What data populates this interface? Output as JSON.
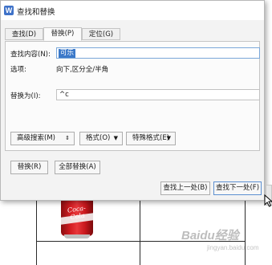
{
  "dialog": {
    "title": "查找和替换",
    "app_icon_letter": "W",
    "tabs": [
      {
        "label": "查找(D)",
        "active": false
      },
      {
        "label": "替换(P)",
        "active": true
      },
      {
        "label": "定位(G)",
        "active": false
      }
    ],
    "find": {
      "label": "查找内容(N):",
      "value": "可乐"
    },
    "options": {
      "label": "选项:",
      "value": "向下,区分全/半角"
    },
    "replace": {
      "label": "替换为(I):",
      "value": "^c"
    },
    "buttons": {
      "advanced": "高级搜索(M)",
      "format": "格式(O)",
      "special": "特殊格式(E)",
      "replace": "替换(R)",
      "replace_all": "全部替换(A)",
      "find_prev": "查找上一处(B)",
      "find_next": "查找下一处(F)"
    }
  },
  "background": {
    "can_brand": "Coca-Cola",
    "watermark": "Baidu经验",
    "watermark_sub": "jingyan.baidu.com"
  }
}
